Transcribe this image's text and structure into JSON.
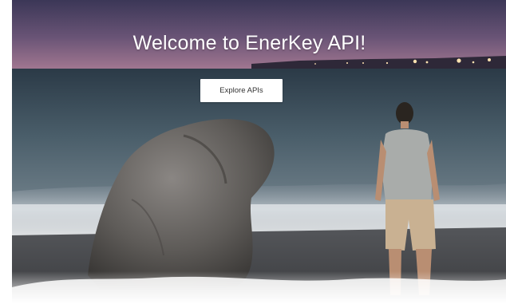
{
  "hero": {
    "title": "Welcome to EnerKey API!",
    "button_label": "Explore APIs"
  },
  "colors": {
    "sky_top": "#3f3a5e",
    "sky_horizon": "#9a6e8e",
    "sea": "#3c4a54",
    "button_bg": "#ffffff",
    "title_color": "#ffffff"
  }
}
